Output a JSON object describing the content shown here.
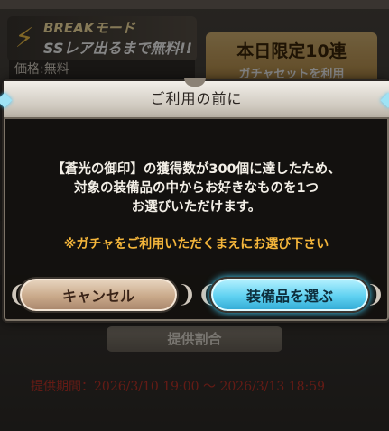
{
  "background": {
    "break_line1": "BREAKモード",
    "break_line2": "SSレア出るまで無料!!",
    "price": "価格:無料",
    "limited_line1": "本日限定10連",
    "limited_line2": "ガチャセットを利用",
    "provide_button": "提供割合",
    "period": "提供期間：2026/3/10 19:00 ～ 2026/3/13 18:59"
  },
  "dialog": {
    "title": "ご利用の前に",
    "message_line1": "【蒼光の御印】の獲得数が300個に達したため、",
    "message_line2": "対象の装備品の中からお好きなものを1つ",
    "message_line3": "お選びいただけます。",
    "notice": "※ガチャをご利用いただくまえにお選び下さい",
    "cancel_label": "キャンセル",
    "select_label": "装備品を選ぶ"
  },
  "colors": {
    "notice": "#f5b63b",
    "period": "#c0342a",
    "select_button": "#5fd1f1",
    "cancel_button": "#c9a98a"
  },
  "icons": {
    "break_icon": "lightning-bolt-icon",
    "ornament": "diamond-ornament-icon"
  }
}
